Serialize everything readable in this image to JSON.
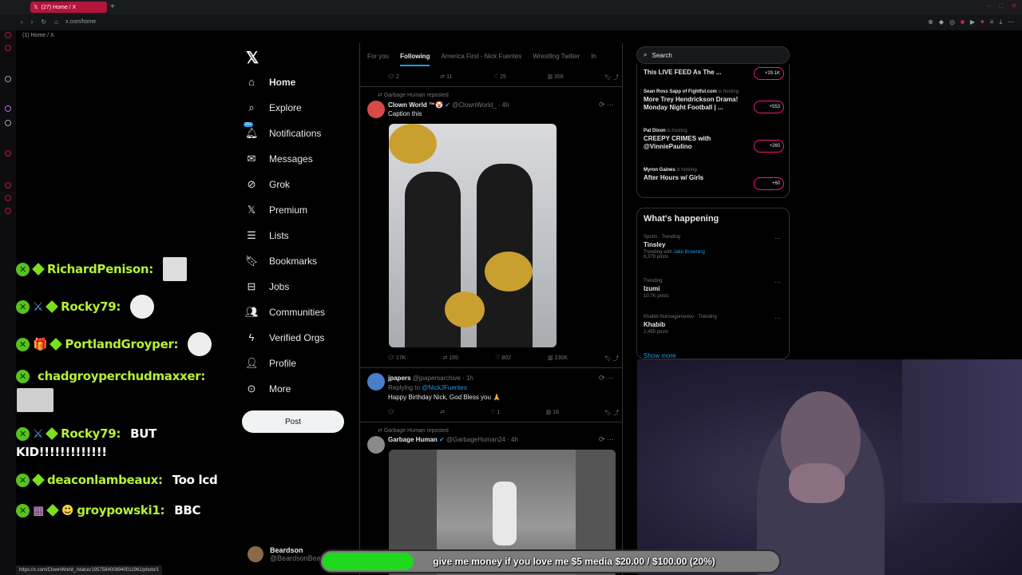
{
  "browser": {
    "tab_title": "(27) Home / X",
    "url": "x.com/home",
    "crumb": "(1) Home / X",
    "status_url": "https://x.com/ClownWorld_/status/1957584008940011961/photo/1"
  },
  "chat": [
    {
      "user": "RichardPenison:",
      "msg": ""
    },
    {
      "user": "Rocky79:",
      "msg": ""
    },
    {
      "user": "PortlandGroyper:",
      "msg": ""
    },
    {
      "user": "chadgroyperchudmaxxer:",
      "msg": ""
    },
    {
      "user": "Rocky79:",
      "msg": "BUT"
    },
    {
      "cont": "KID!!!!!!!!!!!!!"
    },
    {
      "user": "deaconlambeaux:",
      "msg": "Too lcd"
    },
    {
      "user": "groypowski1:",
      "msg": "BBC"
    }
  ],
  "nav": {
    "items": [
      "Home",
      "Explore",
      "Notifications",
      "Messages",
      "Grok",
      "Premium",
      "Lists",
      "Bookmarks",
      "Jobs",
      "Communities",
      "Verified Orgs",
      "Profile",
      "More"
    ],
    "notif_badge": "20+",
    "post_label": "Post",
    "account_name": "Beardson",
    "account_handle": "@BeardsonBea"
  },
  "feed": {
    "tabs": [
      "For you",
      "Following",
      "America First - Nick Fuentes",
      "Wrestling Twitter",
      "In"
    ],
    "top_actions": [
      "2",
      "11",
      "25",
      "358"
    ],
    "tweet1": {
      "repost_note": "Garbage Human reposted",
      "name": "Clown World ™🤡",
      "handle": "@ClownWorld_ · 4h",
      "text": "Caption this",
      "actions": [
        "17K",
        "155",
        "802",
        "230K"
      ]
    },
    "tweet2": {
      "name": "jpapers",
      "handle": "@jpapersarchive · 1h",
      "reply_prefix": "Replying to",
      "reply_to": "@NickJFuentes",
      "text": "Happy Birthday Nick, God Bless you 🙏",
      "actions": [
        "",
        "",
        "1",
        "16"
      ]
    },
    "tweet3": {
      "repost_note": "Garbage Human reposted",
      "name": "Garbage Human",
      "handle": "@GarbageHuman24 · 4h"
    }
  },
  "right": {
    "search_placeholder": "Search",
    "spaces": [
      {
        "host": "",
        "title": "This LIVE FEED As The ...",
        "count": "+29.1K"
      },
      {
        "host": "Sean Ross Sapp of Fightful.com",
        "hosting": "is hosting",
        "title": "More Trey Hendrickson Drama! Monday Night Football | ...",
        "count": "+553"
      },
      {
        "host": "Pat Dixon",
        "hosting": "is hosting",
        "title": "CREEPY CRIMES with @VinniePaulino",
        "count": "+260"
      },
      {
        "host": "Myron Gaines",
        "hosting": "is hosting",
        "title": "After Hours w/ Girls",
        "count": "+60"
      }
    ],
    "happening_title": "What's happening",
    "trends": [
      {
        "meta": "Sports · Trending",
        "name": "Tinsley",
        "sub": "Trending with",
        "sub_link": "Jake Browning",
        "posts": "6,379 posts"
      },
      {
        "meta": "Trending",
        "name": "Izumi",
        "posts": "10.7K posts"
      },
      {
        "meta": "Khabib Nurmagomedov · Trending",
        "name": "Khabib",
        "posts": "2,455 posts"
      }
    ],
    "show_more": "Show more"
  },
  "donation": {
    "text": "give me money if you love me $5 media $20.00 / $100.00 (20%)",
    "progress": 0.2,
    "fill_color": "#1ed91e"
  }
}
